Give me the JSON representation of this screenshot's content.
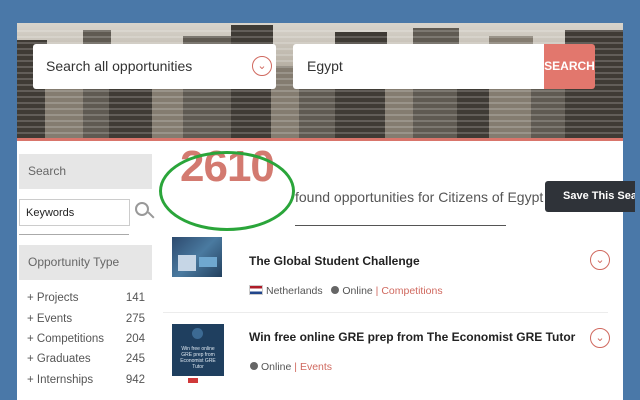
{
  "hero": {
    "search_placeholder": "Search all opportunities",
    "location_value": "Egypt",
    "search_button": "SEARCH"
  },
  "sidebar": {
    "search_heading": "Search",
    "keywords_placeholder": "Keywords",
    "type_heading": "Opportunity Type",
    "types": [
      {
        "label": "+ Projects",
        "count": "141"
      },
      {
        "label": "+ Events",
        "count": "275"
      },
      {
        "label": "+ Competitions",
        "count": "204"
      },
      {
        "label": "+ Graduates",
        "count": "245"
      },
      {
        "label": "+ Internships",
        "count": "942"
      }
    ]
  },
  "results": {
    "count": "2610",
    "found_text": "found opportunities for Citizens of Egypt",
    "save_button": "Save This Sear"
  },
  "cards": [
    {
      "title": "The Global Student Challenge",
      "country": "Netherlands",
      "mode": "Online",
      "category": "Competitions"
    },
    {
      "title": "Win free online GRE prep from The Economist GRE Tutor",
      "mode": "Online",
      "category": "Events",
      "thumb_text": "Win free online GRE prep from Economist GRE Tutor"
    }
  ],
  "colors": {
    "accent": "#d0695f",
    "count": "#d37a70",
    "highlight_oval": "#2aa53a",
    "save_button_bg": "#2f3339",
    "page_bg": "#4a78a8"
  }
}
